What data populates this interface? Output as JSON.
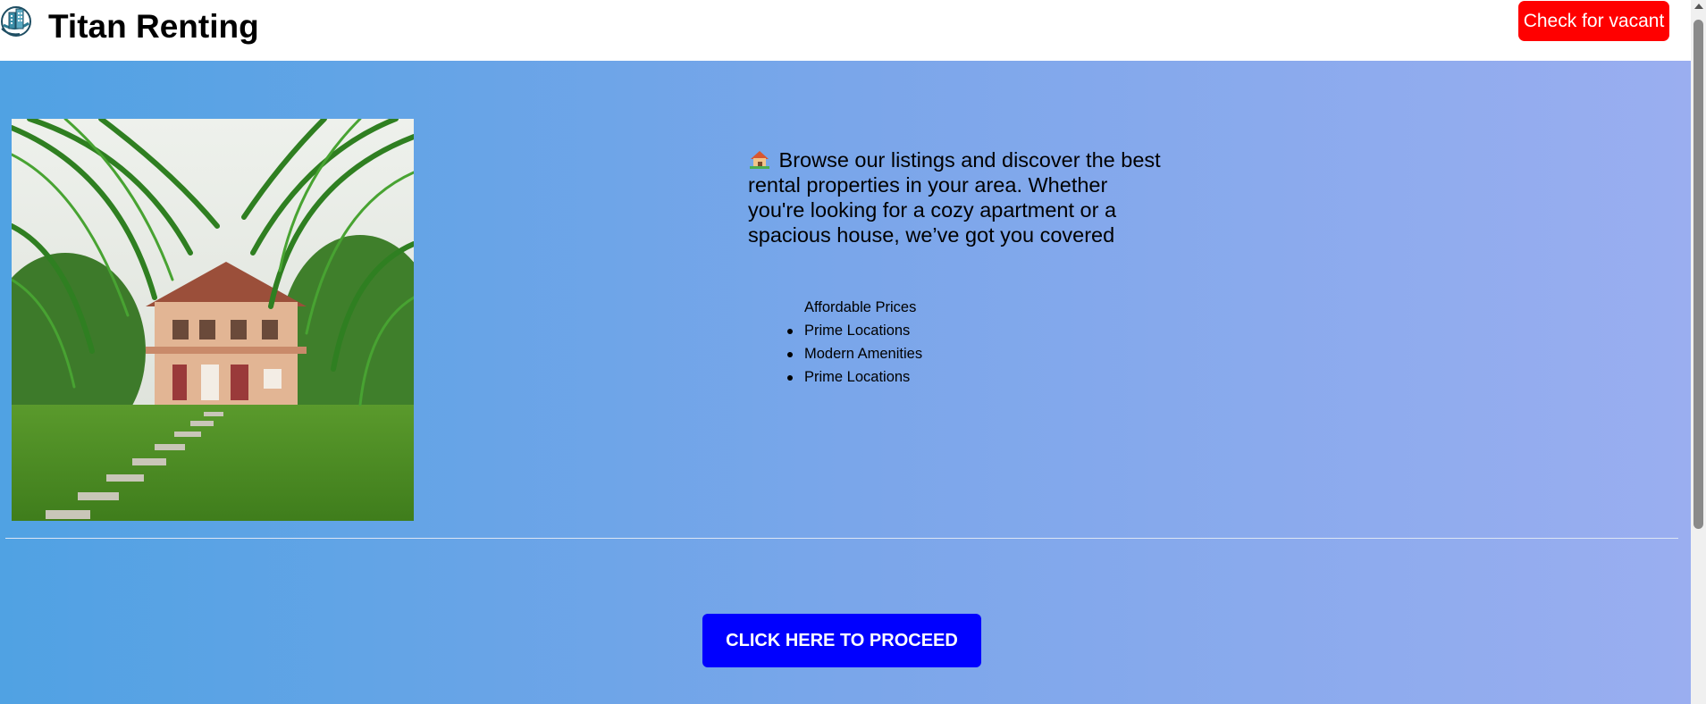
{
  "header": {
    "title": "Titan Renting",
    "logo_icon": "building-globe-logo-icon",
    "vacant_button_label": "Check for vacant"
  },
  "main": {
    "photo": "house-with-palm-trees-photo",
    "intro_emoji": "house-emoji-icon",
    "intro_text": "Browse our listings and discover the best rental properties in your area. Whether you're looking for a cozy apartment or a spacious house, we’ve got you covered",
    "features": [
      "Affordable Prices",
      "Prime Locations",
      "Modern Amenities",
      "Prime Locations"
    ],
    "proceed_button_label": "CLICK HERE TO PROCEED"
  },
  "colors": {
    "vacant_button": "#ff0000",
    "proceed_button": "#0000ff",
    "gradient_start": "#50a2e3",
    "gradient_end": "#9aaef0"
  }
}
